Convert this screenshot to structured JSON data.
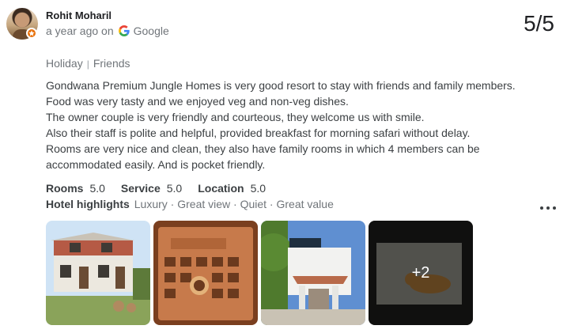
{
  "review": {
    "author": "Rohit Moharil",
    "time_ago": "a year ago on",
    "source": "Google",
    "rating": "5/5",
    "tags": [
      "Holiday",
      "Friends"
    ],
    "tag_separator": "|",
    "lines": [
      "Gondwana Premium Jungle Homes is very good resort to stay with friends and family members.",
      "Food was very tasty and we enjoyed veg and non-veg dishes.",
      "The owner couple is very friendly and courteous, they welcome us with smile.",
      "Also their staff is polite and helpful, provided breakfast for morning safari without delay.",
      "Rooms are very nice and clean, they also have family rooms in which 4 members can be",
      "accommodated easily. And is pocket friendly."
    ],
    "scores": [
      {
        "label": "Rooms",
        "value": "5.0"
      },
      {
        "label": "Service",
        "value": "5.0"
      },
      {
        "label": "Location",
        "value": "5.0"
      }
    ],
    "highlights_label": "Hotel highlights",
    "highlights": "Luxury · Great view · Quiet · Great value",
    "extra_photos": "+2"
  },
  "icons": {
    "guide_badge": "local-guide-star-icon",
    "google": "google-g-icon",
    "menu": "more-options-icon"
  },
  "colors": {
    "guide_badge": "#e8710a",
    "text_primary": "#202124",
    "text_secondary": "#70757a"
  }
}
